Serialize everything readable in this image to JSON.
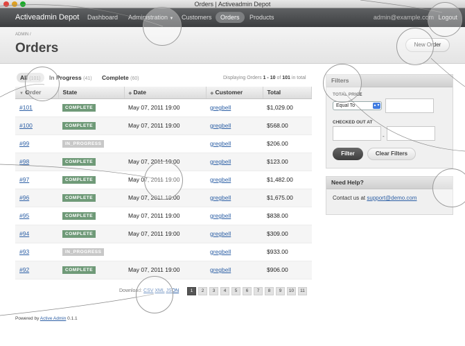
{
  "window": {
    "title": "Orders | Activeadmin Depot"
  },
  "header": {
    "site_title": "Activeadmin Depot",
    "nav": [
      "Dashboard",
      "Administration",
      "Customers",
      "Orders",
      "Products"
    ],
    "user_email": "admin@example.com",
    "logout": "Logout"
  },
  "page": {
    "breadcrumb": "ADMIN /",
    "title": "Orders",
    "new_button": "New Order"
  },
  "scopes": [
    {
      "label": "All",
      "count": "(101)"
    },
    {
      "label": "In Progress",
      "count": "(41)"
    },
    {
      "label": "Complete",
      "count": "(60)"
    }
  ],
  "displaying": {
    "prefix": "Displaying Orders",
    "range": "1 - 10",
    "of": "of",
    "total": "101",
    "suffix": "in total"
  },
  "table": {
    "columns": [
      "Order",
      "State",
      "Date",
      "Customer",
      "Total"
    ],
    "rows": [
      {
        "order": "#101",
        "state": "COMPLETE",
        "date": "May 07, 2011 19:00",
        "customer": "gregbell",
        "total": "$1,029.00"
      },
      {
        "order": "#100",
        "state": "COMPLETE",
        "date": "May 07, 2011 19:00",
        "customer": "gregbell",
        "total": "$568.00"
      },
      {
        "order": "#99",
        "state": "IN_PROGRESS",
        "date": "",
        "customer": "gregbell",
        "total": "$206.00"
      },
      {
        "order": "#98",
        "state": "COMPLETE",
        "date": "May 07, 2011 19:00",
        "customer": "gregbell",
        "total": "$123.00"
      },
      {
        "order": "#97",
        "state": "COMPLETE",
        "date": "May 07, 2011 19:00",
        "customer": "gregbell",
        "total": "$1,482.00"
      },
      {
        "order": "#96",
        "state": "COMPLETE",
        "date": "May 07, 2011 19:00",
        "customer": "gregbell",
        "total": "$1,675.00"
      },
      {
        "order": "#95",
        "state": "COMPLETE",
        "date": "May 07, 2011 19:00",
        "customer": "gregbell",
        "total": "$838.00"
      },
      {
        "order": "#94",
        "state": "COMPLETE",
        "date": "May 07, 2011 19:00",
        "customer": "gregbell",
        "total": "$309.00"
      },
      {
        "order": "#93",
        "state": "IN_PROGRESS",
        "date": "",
        "customer": "gregbell",
        "total": "$933.00"
      },
      {
        "order": "#92",
        "state": "COMPLETE",
        "date": "May 07, 2011 19:00",
        "customer": "gregbell",
        "total": "$906.00"
      }
    ]
  },
  "download": {
    "label": "Download:",
    "formats": [
      "CSV",
      "XML",
      "JSON"
    ]
  },
  "pagination": {
    "current": "1",
    "pages": [
      "1",
      "2",
      "3",
      "4",
      "5",
      "6",
      "7",
      "8",
      "9",
      "10",
      "11"
    ]
  },
  "footer": {
    "prefix": "Powered by",
    "link": "Active Admin",
    "version": "0.1.1"
  },
  "filters": {
    "title": "Filters",
    "total_price_label": "TOTAL PRICE",
    "total_price_operator": "Equal To",
    "total_price_value": "",
    "checked_out_label": "CHECKED OUT AT",
    "checked_out_from": "",
    "checked_out_to": "",
    "range_separator": "-",
    "filter_button": "Filter",
    "clear_button": "Clear Filters"
  },
  "help": {
    "title": "Need Help?",
    "text": "Contact us at",
    "email": "support@demo.com"
  },
  "colors": {
    "header": "#4a4c4e",
    "complete_badge": "#6f9a78",
    "in_progress_badge": "#c8c8c8",
    "link": "#2c5fa5"
  }
}
